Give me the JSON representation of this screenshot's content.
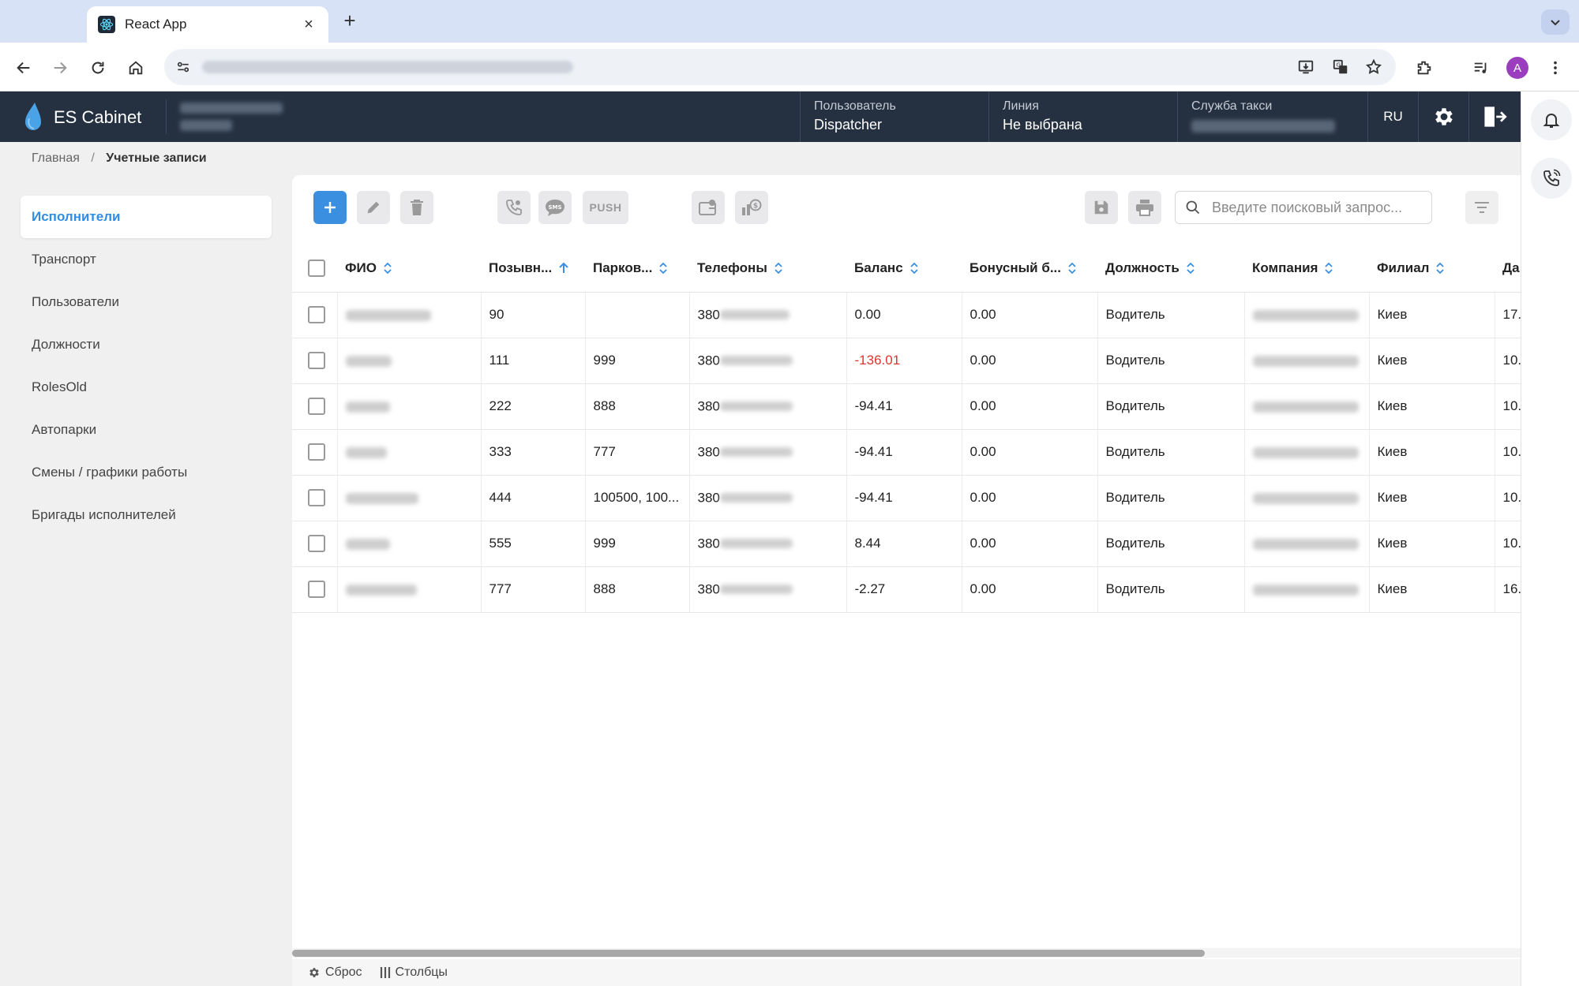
{
  "browser": {
    "tab_title": "React App",
    "tab_close": "×",
    "new_tab": "+",
    "avatar_letter": "A"
  },
  "app": {
    "brand": "ES Cabinet",
    "user_label": "Пользователь",
    "user_value": "Dispatcher",
    "line_label": "Линия",
    "line_value": "Не выбрана",
    "taxi_label": "Служба такси",
    "lang": "RU"
  },
  "breadcrumb": {
    "home": "Главная",
    "separator": "/",
    "current": "Учетные записи"
  },
  "sidebar": {
    "items": [
      {
        "label": "Исполнители",
        "active": true
      },
      {
        "label": "Транспорт"
      },
      {
        "label": "Пользователи"
      },
      {
        "label": "Должности"
      },
      {
        "label": "RolesOld"
      },
      {
        "label": "Автопарки"
      },
      {
        "label": "Смены / графики работы"
      },
      {
        "label": "Бригады исполнителей"
      }
    ]
  },
  "actions": {
    "push_label": "PUSH",
    "sms_label": "SMS",
    "search_placeholder": "Введите поисковый запрос..."
  },
  "table": {
    "columns": [
      "ФИО",
      "Позывн...",
      "Парков...",
      "Телефоны",
      "Баланс",
      "Бонусный б...",
      "Должность",
      "Компания",
      "Филиал",
      "Да"
    ],
    "rows": [
      {
        "callsign": "90",
        "park": "",
        "phone_prefix": "380",
        "balance": "0.00",
        "bonus": "0.00",
        "position": "Водитель",
        "branch": "Киев",
        "date": "17."
      },
      {
        "callsign": "111",
        "park": "999",
        "phone_prefix": "380",
        "balance": "-136.01",
        "bonus": "0.00",
        "position": "Водитель",
        "branch": "Киев",
        "date": "10."
      },
      {
        "callsign": "222",
        "park": "888",
        "phone_prefix": "380",
        "balance": "-94.41",
        "bonus": "0.00",
        "position": "Водитель",
        "branch": "Киев",
        "date": "10."
      },
      {
        "callsign": "333",
        "park": "777",
        "phone_prefix": "380",
        "balance": "-94.41",
        "bonus": "0.00",
        "position": "Водитель",
        "branch": "Киев",
        "date": "10."
      },
      {
        "callsign": "444",
        "park": "100500, 100...",
        "phone_prefix": "380",
        "balance": "-94.41",
        "bonus": "0.00",
        "position": "Водитель",
        "branch": "Киев",
        "date": "10."
      },
      {
        "callsign": "555",
        "park": "999",
        "phone_prefix": "380",
        "balance": "8.44",
        "bonus": "0.00",
        "position": "Водитель",
        "branch": "Киев",
        "date": "10."
      },
      {
        "callsign": "777",
        "park": "888",
        "phone_prefix": "380",
        "balance": "-2.27",
        "bonus": "0.00",
        "position": "Водитель",
        "branch": "Киев",
        "date": "16."
      }
    ]
  },
  "footer": {
    "reset": "Сброс",
    "columns": "Столбцы"
  },
  "colors": {
    "accent": "#2f8de4",
    "appbar": "#253140",
    "negative": "#e0352b"
  }
}
